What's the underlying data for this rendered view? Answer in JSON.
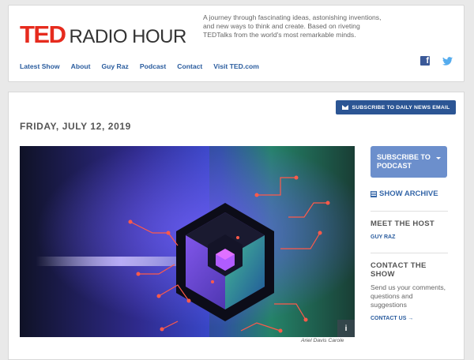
{
  "brand": {
    "ted": "TED",
    "radio_hour": "RADIO HOUR",
    "accent": "#e62b1e"
  },
  "header": {
    "tagline": "A journey through fascinating ideas, astonishing inventions, and new ways to think and create. Based on riveting TEDTalks from the world's most remarkable minds."
  },
  "nav": [
    {
      "label": "Latest Show"
    },
    {
      "label": "About"
    },
    {
      "label": "Guy Raz"
    },
    {
      "label": "Podcast"
    },
    {
      "label": "Contact"
    },
    {
      "label": "Visit TED.com"
    }
  ],
  "social": {
    "facebook_icon": "facebook-icon",
    "twitter_icon": "twitter-icon",
    "facebook_glyph": "f"
  },
  "main": {
    "subscribe_email_label": "SUBSCRIBE TO DAILY NEWS EMAIL",
    "date": "FRIDAY, JULY 12, 2019",
    "hero_credit": "Ariel Davis Carole",
    "info_label": "i"
  },
  "sidebar": {
    "subscribe_podcast_line1": "SUBSCRIBE TO",
    "subscribe_podcast_line2": "PODCAST",
    "show_archive": "SHOW ARCHIVE",
    "meet_host_heading": "MEET THE HOST",
    "host_name": "GUY RAZ",
    "contact_heading_line1": "CONTACT THE",
    "contact_heading_line2": "SHOW",
    "contact_text": "Send us your comments, questions and suggestions",
    "contact_link": "CONTACT US →"
  }
}
